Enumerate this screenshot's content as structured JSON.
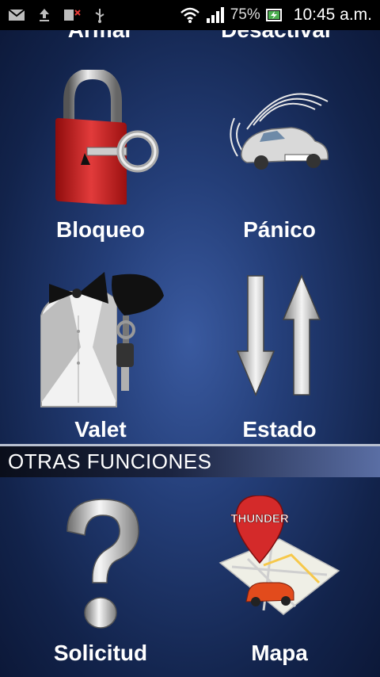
{
  "status_bar": {
    "battery": "75%",
    "time": "10:45 a.m."
  },
  "grid_top": {
    "clipped_left": "Armar",
    "clipped_right": "Desactivar"
  },
  "tiles": {
    "bloqueo": "Bloqueo",
    "panico": "Pánico",
    "valet": "Valet",
    "estado": "Estado"
  },
  "section_header": "OTRAS FUNCIONES",
  "other_tiles": {
    "solicitud": "Solicitud",
    "mapa": "Mapa",
    "map_pin_text": "THUNDER"
  },
  "icons": [
    "gmail-icon",
    "upload-icon",
    "missed-call-icon",
    "usb-icon",
    "wifi-icon",
    "signal-icon",
    "battery-charging-icon",
    "lock-key-icon",
    "car-alarm-icon",
    "tuxedo-key-icon",
    "up-down-arrows-icon",
    "question-mark-icon",
    "map-pin-icon"
  ]
}
